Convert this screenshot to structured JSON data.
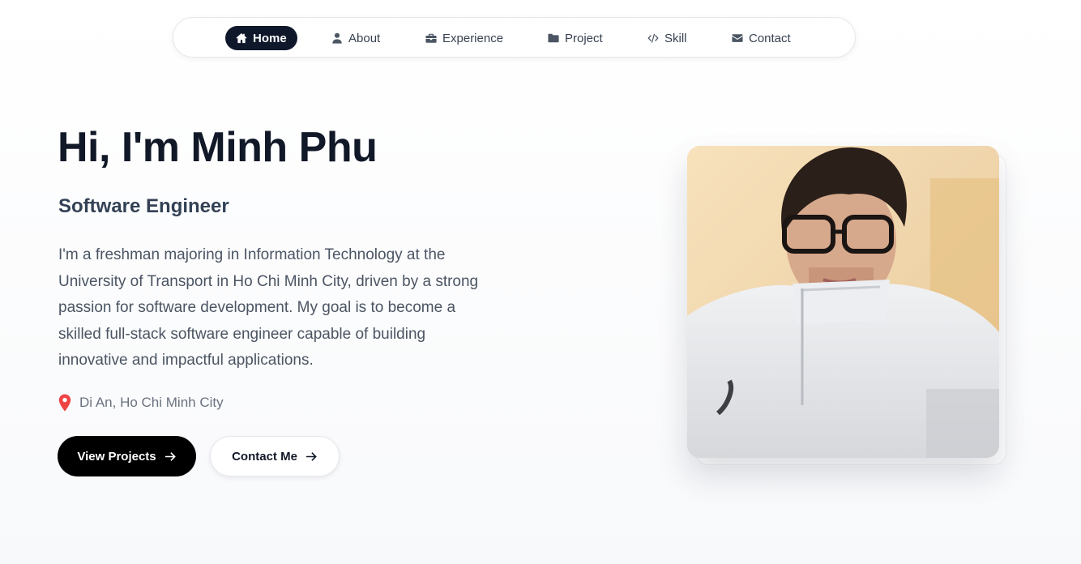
{
  "nav": {
    "items": [
      {
        "label": "Home",
        "icon": "home-icon",
        "active": true
      },
      {
        "label": "About",
        "icon": "user-icon",
        "active": false
      },
      {
        "label": "Experience",
        "icon": "briefcase-icon",
        "active": false
      },
      {
        "label": "Project",
        "icon": "folder-icon",
        "active": false
      },
      {
        "label": "Skill",
        "icon": "code-icon",
        "active": false
      },
      {
        "label": "Contact",
        "icon": "envelope-icon",
        "active": false
      }
    ]
  },
  "hero": {
    "title": "Hi, I'm Minh Phu",
    "role": "Software Engineer",
    "description": "I'm a freshman majoring in Information Technology at the University of Transport in Ho Chi Minh City, driven by a strong passion for software development. My goal is to become a skilled full-stack software engineer capable of building innovative and impactful applications.",
    "location": "Di An, Ho Chi Minh City",
    "location_icon": "map-pin-icon",
    "primary_button": "View Projects",
    "secondary_button": "Contact Me",
    "button_icon": "arrow-right-icon"
  },
  "colors": {
    "accent_dark": "#0f172a",
    "button_primary": "#000000",
    "pin": "#ef4444",
    "photo_background": "#f6dfb6"
  }
}
